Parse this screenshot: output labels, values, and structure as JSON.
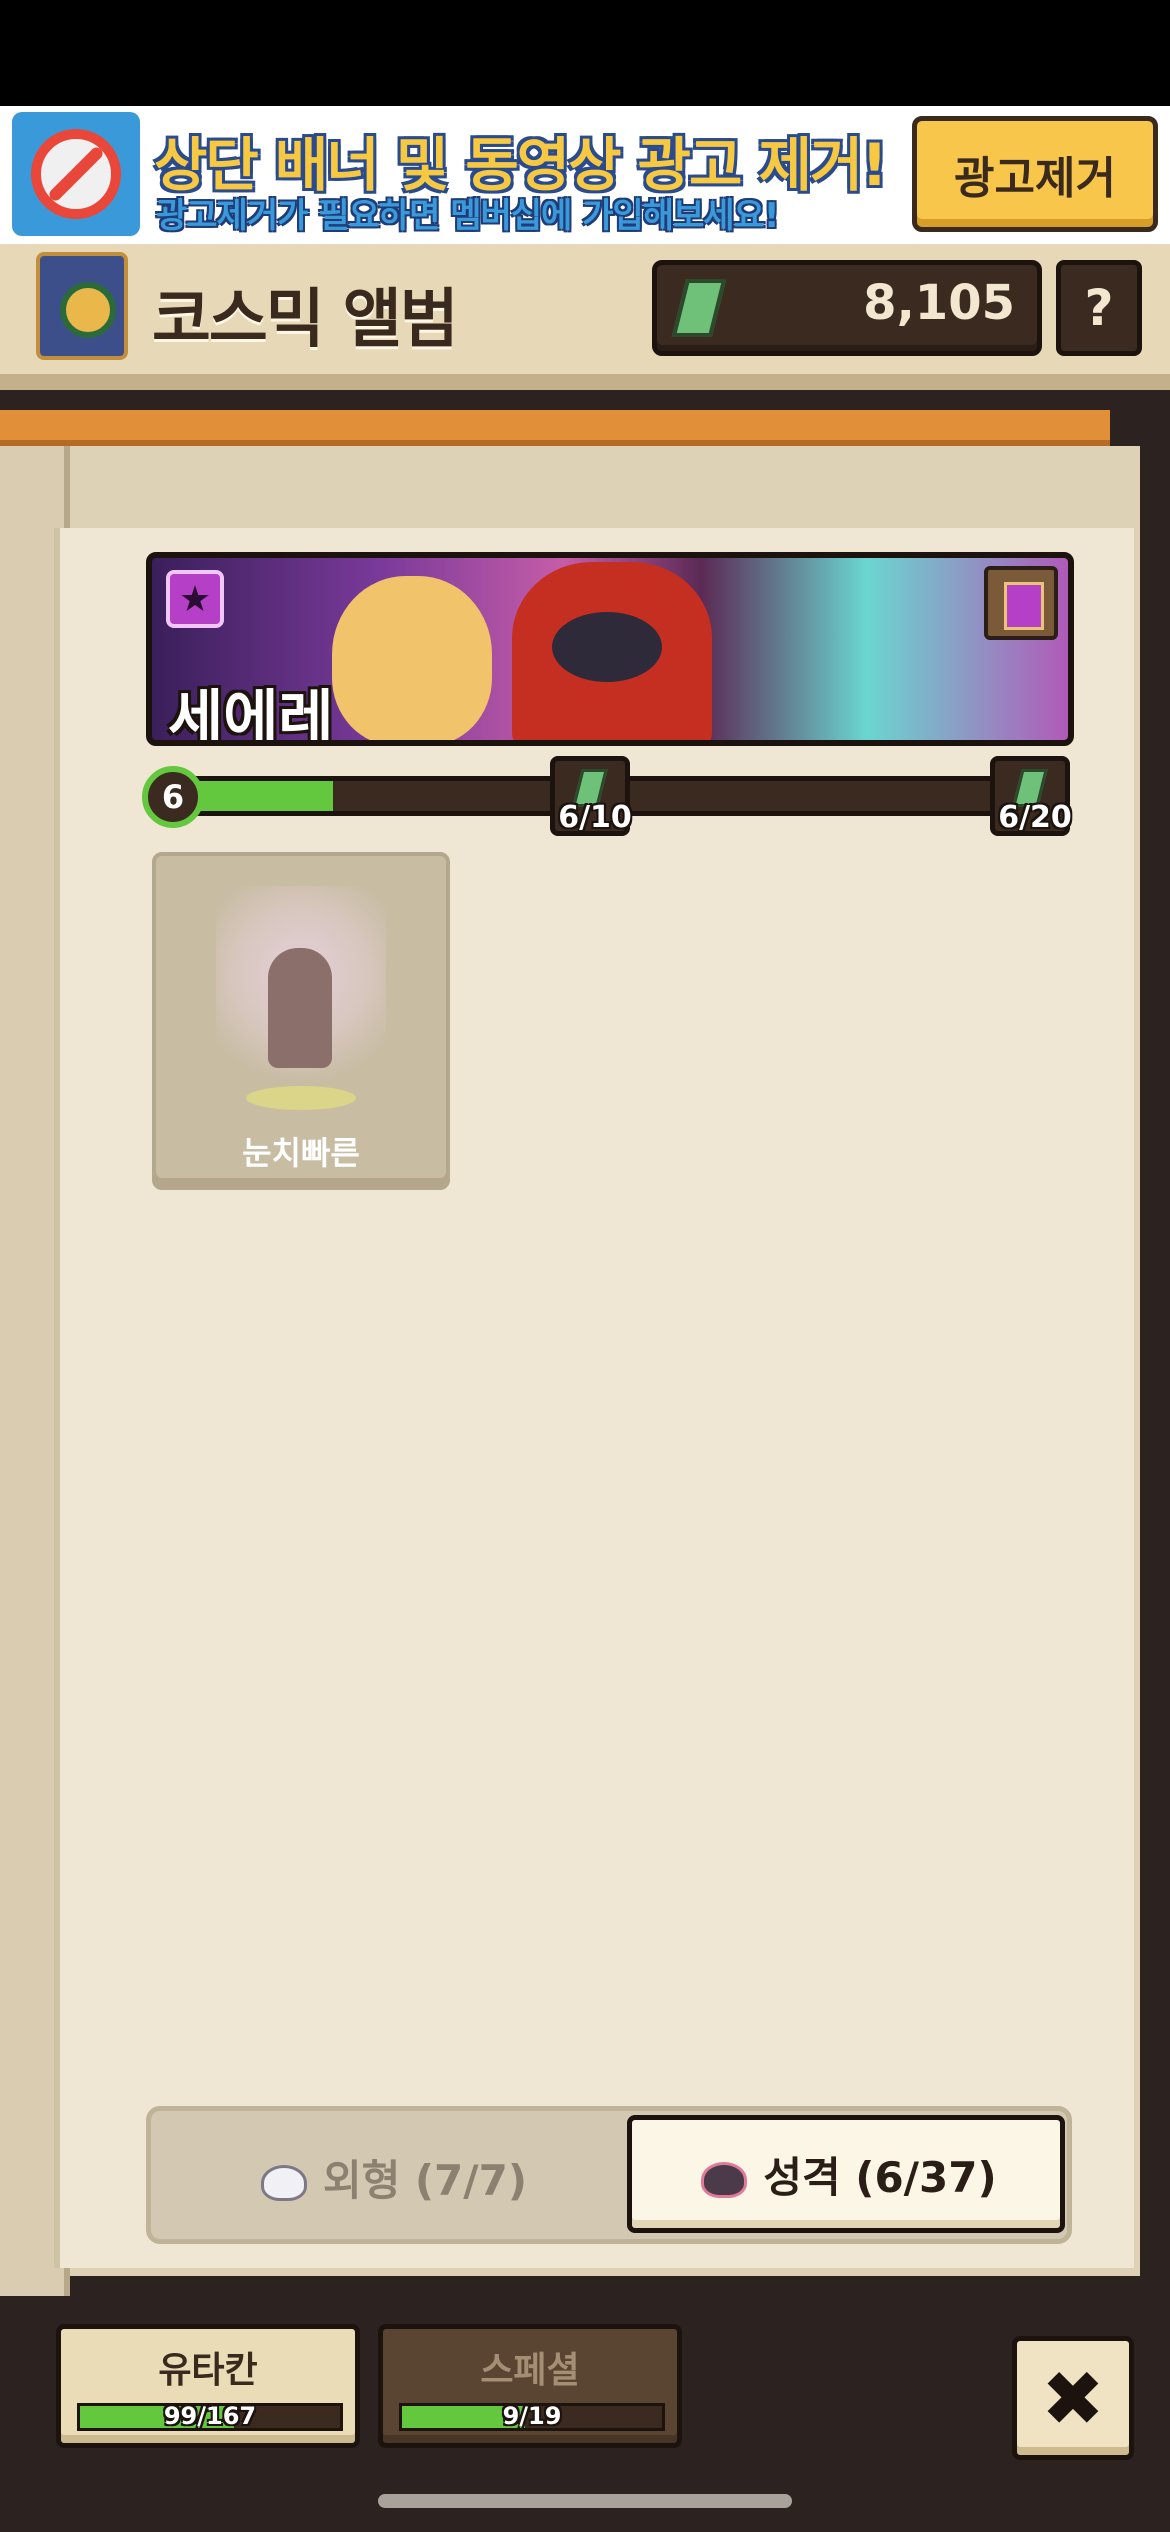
{
  "ad_banner": {
    "title": "상단 배너 및 동영상 광고 제거!",
    "subtitle": "광고제거가 필요하면 멤버십에 가입해보세요!",
    "remove_button": "광고제거",
    "icon": "no-ads-clock-icon"
  },
  "header": {
    "title": "코스믹 앨범",
    "currency_value": "8,105",
    "currency_icon": "green-crystal-icon",
    "help_label": "?"
  },
  "character": {
    "name": "세에레",
    "level": "6",
    "progress": 0.18,
    "milestones": [
      {
        "label": "6/10",
        "icon": "green-crystal-icon"
      },
      {
        "label": "6/20",
        "icon": "green-crystal-icon"
      }
    ]
  },
  "cards": [
    {
      "label": "눈치빠른"
    }
  ],
  "tabs": {
    "appearance": "외형 (7/7)",
    "personality": "성격 (6/37)"
  },
  "categories": [
    {
      "label": "유타칸",
      "progress_text": "99/167",
      "progress": 0.593
    },
    {
      "label": "스페셜",
      "progress_text": "9/19",
      "progress": 0.474
    }
  ],
  "close_label": "✖",
  "colors": {
    "accent_green": "#64c83e",
    "ad_yellow": "#f7c64a",
    "page_bg": "#efe6d3",
    "dark_brown": "#2c2320"
  }
}
